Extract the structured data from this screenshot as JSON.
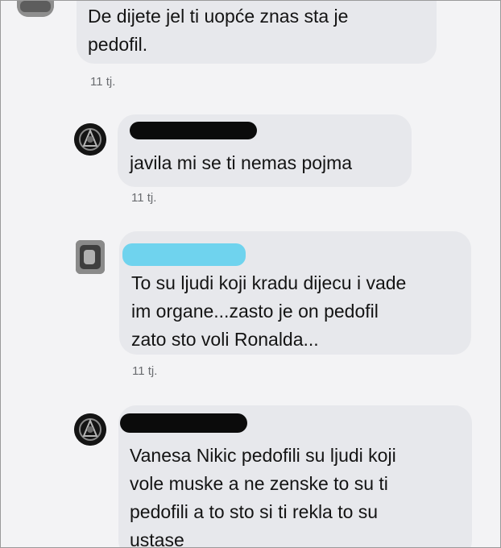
{
  "comments": [
    {
      "text": "De dijete jel ti uopće znas sta je\npedofil.",
      "time": "11 tj."
    },
    {
      "text": "javila mi se ti nemas pojma",
      "time": "11 tj."
    },
    {
      "text": "To su ljudi koji kradu dijecu i vade\nim organe...zasto je on pedofil\nzato sto voli Ronalda...",
      "time": "11 tj."
    },
    {
      "text": "Vanesa Nikic pedofili su ljudi koji\nvole muske a ne zenske to su ti\npedofili a to sto si ti rekla  to su\nustase"
    }
  ],
  "colors": {
    "bubble": "#e7e8ec",
    "timestamp": "#6a6c70",
    "redaction_black": "#0b0b0b",
    "redaction_blue": "#6fd3ee"
  }
}
